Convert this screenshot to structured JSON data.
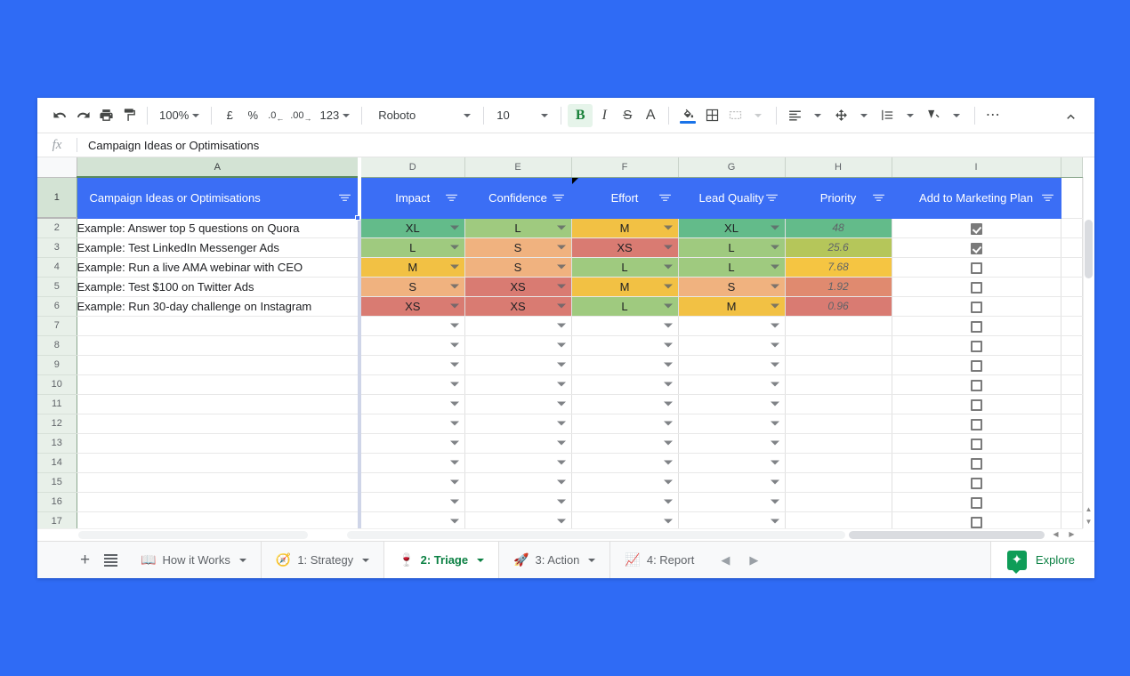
{
  "toolbar": {
    "undo_icon": "undo-icon",
    "redo_icon": "redo-icon",
    "print_icon": "print-icon",
    "paint_format_icon": "paint-format-icon",
    "zoom_value": "100%",
    "currency_label": "£",
    "percent_label": "%",
    "dec_decrease_label": ".0",
    "dec_increase_label": ".00",
    "format_label": "123",
    "font_name": "Roboto",
    "font_size": "10",
    "bold_label": "B",
    "italic_label": "I",
    "strike_label": "S",
    "text_color_label": "A",
    "fill_icon": "fill-color-icon",
    "borders_icon": "borders-icon",
    "merge_icon": "merge-cells-icon",
    "halign_icon": "horizontal-align-icon",
    "valign_icon": "vertical-align-icon",
    "wrap_icon": "text-wrap-icon",
    "rotate_icon": "text-rotation-icon",
    "more_label": "⋯",
    "collapse_icon": "collapse-toolbar-icon"
  },
  "formula_bar": {
    "fx_label": "fx",
    "value": "Campaign Ideas or Optimisations"
  },
  "grid": {
    "column_letters": [
      "A",
      "D",
      "E",
      "F",
      "G",
      "H",
      "I"
    ],
    "row_numbers": [
      "1",
      "2",
      "3",
      "4",
      "5",
      "6",
      "7",
      "8",
      "9",
      "10",
      "11",
      "12",
      "13",
      "14",
      "15",
      "16",
      "17"
    ],
    "headers": [
      "Campaign Ideas or Optimisations",
      "Impact",
      "Confidence",
      "Effort",
      "Lead Quality",
      "Priority",
      "Add to Marketing Plan"
    ],
    "rows": [
      {
        "task": "Example: Answer top 5 questions on Quora",
        "impact": "XL",
        "confidence": "L",
        "effort": "M",
        "lead_quality": "XL",
        "priority": "48",
        "add_to_plan": true
      },
      {
        "task": "Example: Test LinkedIn Messenger Ads",
        "impact": "L",
        "confidence": "S",
        "effort": "XS",
        "lead_quality": "L",
        "priority": "25.6",
        "add_to_plan": true
      },
      {
        "task": "Example: Run a live AMA webinar with CEO",
        "impact": "M",
        "confidence": "S",
        "effort": "L",
        "lead_quality": "L",
        "priority": "7.68",
        "add_to_plan": false
      },
      {
        "task": "Example: Test $100 on Twitter Ads",
        "impact": "S",
        "confidence": "XS",
        "effort": "M",
        "lead_quality": "S",
        "priority": "1.92",
        "add_to_plan": false
      },
      {
        "task": "Example: Run 30-day challenge on Instagram",
        "impact": "XS",
        "confidence": "XS",
        "effort": "L",
        "lead_quality": "M",
        "priority": "0.96",
        "add_to_plan": false
      }
    ],
    "empty_row_count": 11,
    "scale_colors": {
      "XL": "#63bb8a",
      "L": "#9fca7f",
      "M": "#f2c144",
      "S": "#f0b27f",
      "XS": "#d97b72"
    },
    "priority_colors": [
      "#63bb8a",
      "#b5c65a",
      "#f5c542",
      "#e08a6f",
      "#d97b72"
    ],
    "header_color": "#3b6ef5"
  },
  "sheet_tabs": {
    "add_label": "+",
    "all_sheets_icon": "all-sheets-icon",
    "tabs": [
      {
        "emoji": "📖",
        "label": "How it Works",
        "active": false
      },
      {
        "emoji": "🧭",
        "label": "1: Strategy",
        "active": false
      },
      {
        "emoji": "🍷",
        "label": "2: Triage",
        "active": true
      },
      {
        "emoji": "🚀",
        "label": "3: Action",
        "active": false
      },
      {
        "emoji": "📈",
        "label": "4: Report",
        "active": false
      }
    ],
    "prev_icon": "previous-sheet-icon",
    "next_icon": "next-sheet-icon",
    "explore_label": "Explore",
    "explore_icon": "explore-icon"
  }
}
